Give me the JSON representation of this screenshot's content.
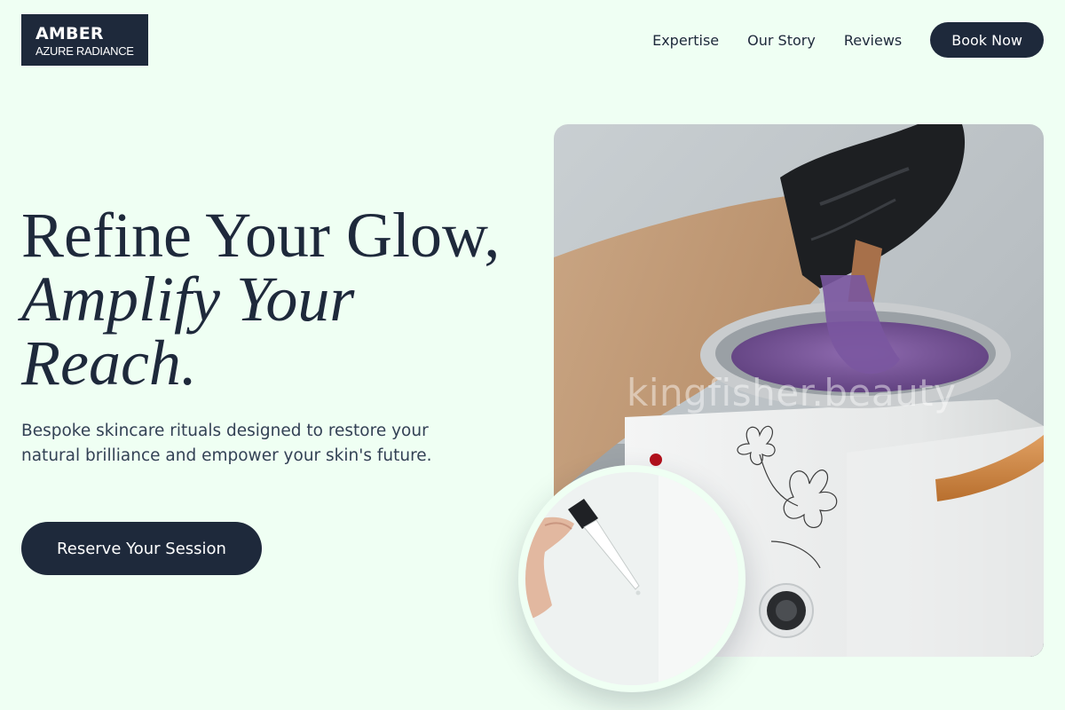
{
  "brand": {
    "name": "AMBER",
    "tagline": "AZURE RADIANCE"
  },
  "nav": {
    "links": [
      "Expertise",
      "Our Story",
      "Reviews"
    ],
    "cta_label": "Book Now"
  },
  "hero": {
    "headline_line1": "Refine Your Glow,",
    "headline_accent": "Amplify Your Reach.",
    "description": "Bespoke skincare rituals designed to restore your natural brilliance and empower your skin's future.",
    "cta_label": "Reserve Your Session",
    "image_watermark": "kingfisher.beauty"
  },
  "colors": {
    "background": "#effff3",
    "primary": "#1e293b",
    "text_muted": "#334155"
  }
}
